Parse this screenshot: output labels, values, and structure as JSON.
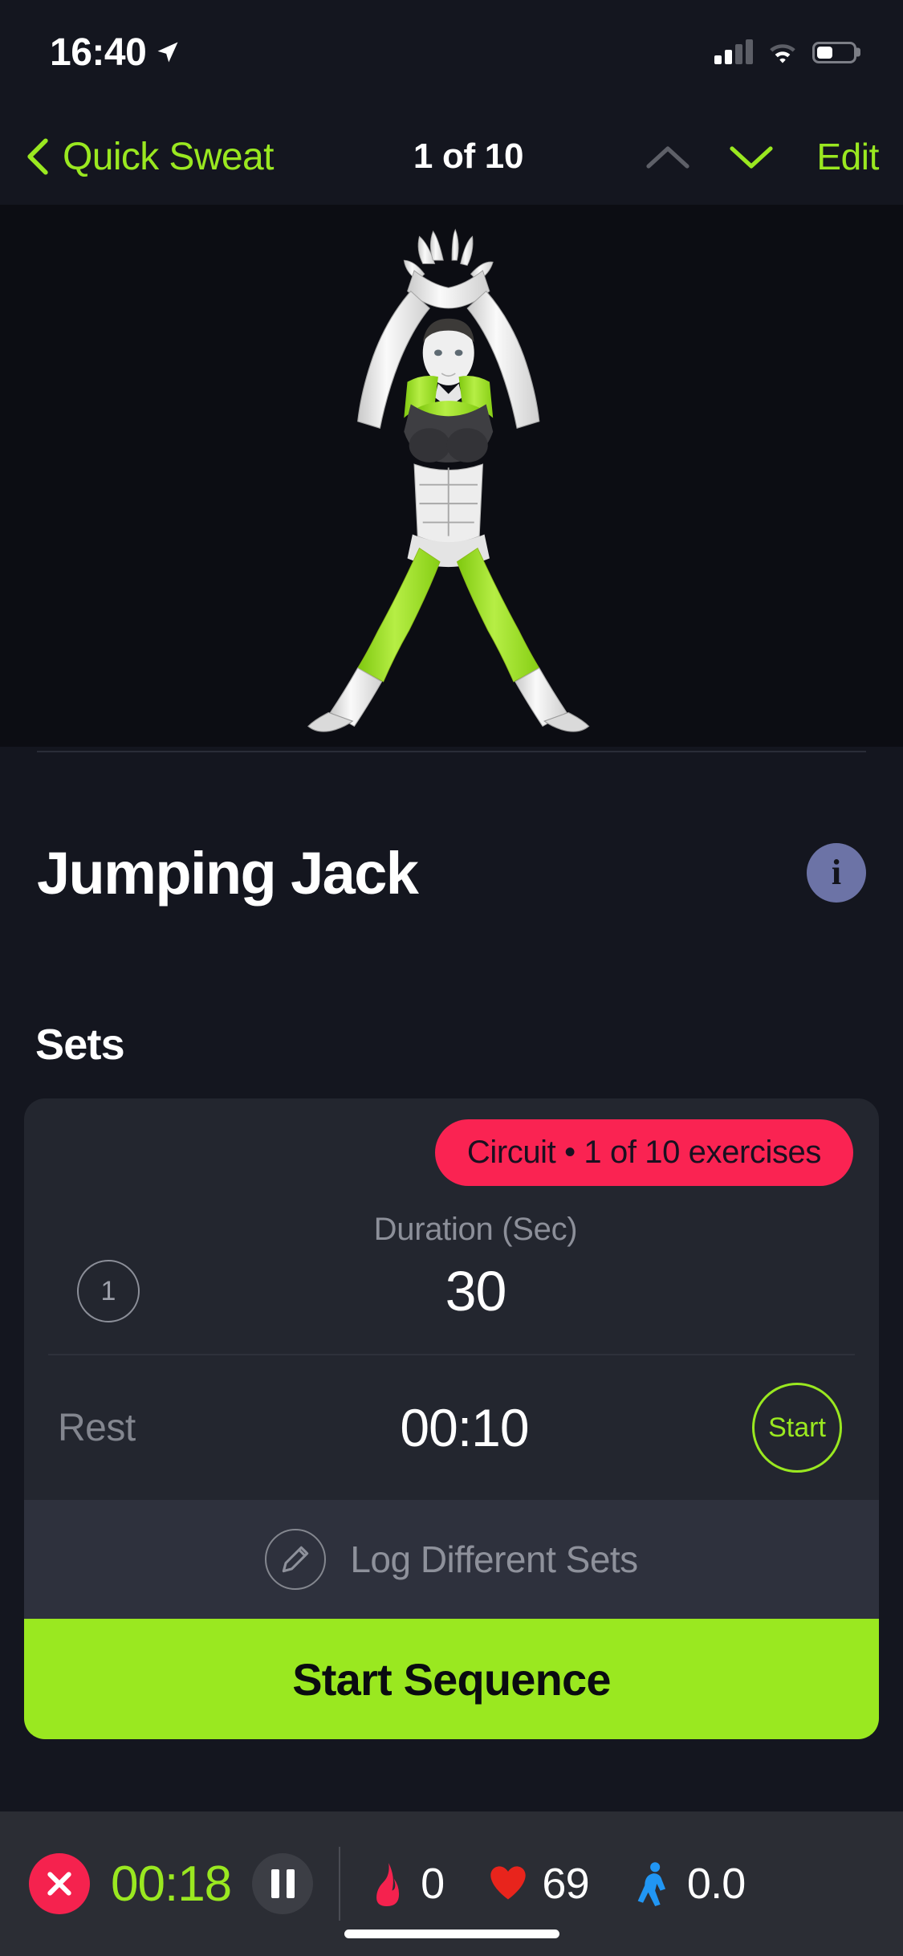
{
  "status_bar": {
    "time": "16:40",
    "location_icon": "location-arrow-icon",
    "cellular_icon": "cellular-signal-icon",
    "cellular_bars_filled": 2,
    "cellular_bars_total": 4,
    "wifi_icon": "wifi-icon",
    "battery_icon": "battery-icon",
    "battery_level_percent": 45
  },
  "nav": {
    "back_icon": "chevron-left-icon",
    "back_label": "Quick Sweat",
    "counter": "1 of 10",
    "prev_icon": "chevron-up-icon",
    "next_icon": "chevron-down-icon",
    "edit_label": "Edit"
  },
  "hero": {
    "image_name": "jumping-jack-anatomy-illustration",
    "alt": "Anatomical figure performing a jumping jack with highlighted muscles"
  },
  "exercise": {
    "title": "Jumping Jack",
    "info_icon": "info-icon",
    "info_glyph": "i"
  },
  "sets": {
    "heading": "Sets",
    "circuit_badge": "Circuit • 1 of 10 exercises",
    "column_header": "Duration (Sec)",
    "rows": [
      {
        "set_number": "1",
        "duration": "30"
      }
    ],
    "rest_label": "Rest",
    "rest_value": "00:10",
    "rest_start_label": "Start",
    "log_icon": "pencil-icon",
    "log_label": "Log Different Sets",
    "start_sequence_label": "Start Sequence"
  },
  "tracker": {
    "close_icon": "close-x-icon",
    "elapsed": "00:18",
    "pause_icon": "pause-icon",
    "stats": [
      {
        "icon": "flame-icon",
        "value": "0"
      },
      {
        "icon": "heart-icon",
        "value": "69"
      },
      {
        "icon": "walking-icon",
        "value": "0.0"
      }
    ]
  },
  "colors": {
    "accent_green": "#9AE820",
    "badge_pink": "#FA2352",
    "close_red": "#F5224E",
    "info_blue": "#6C73A6",
    "heart_red": "#E8241C",
    "walk_blue": "#2196F3",
    "background": "#14161F",
    "card": "#23262F"
  }
}
